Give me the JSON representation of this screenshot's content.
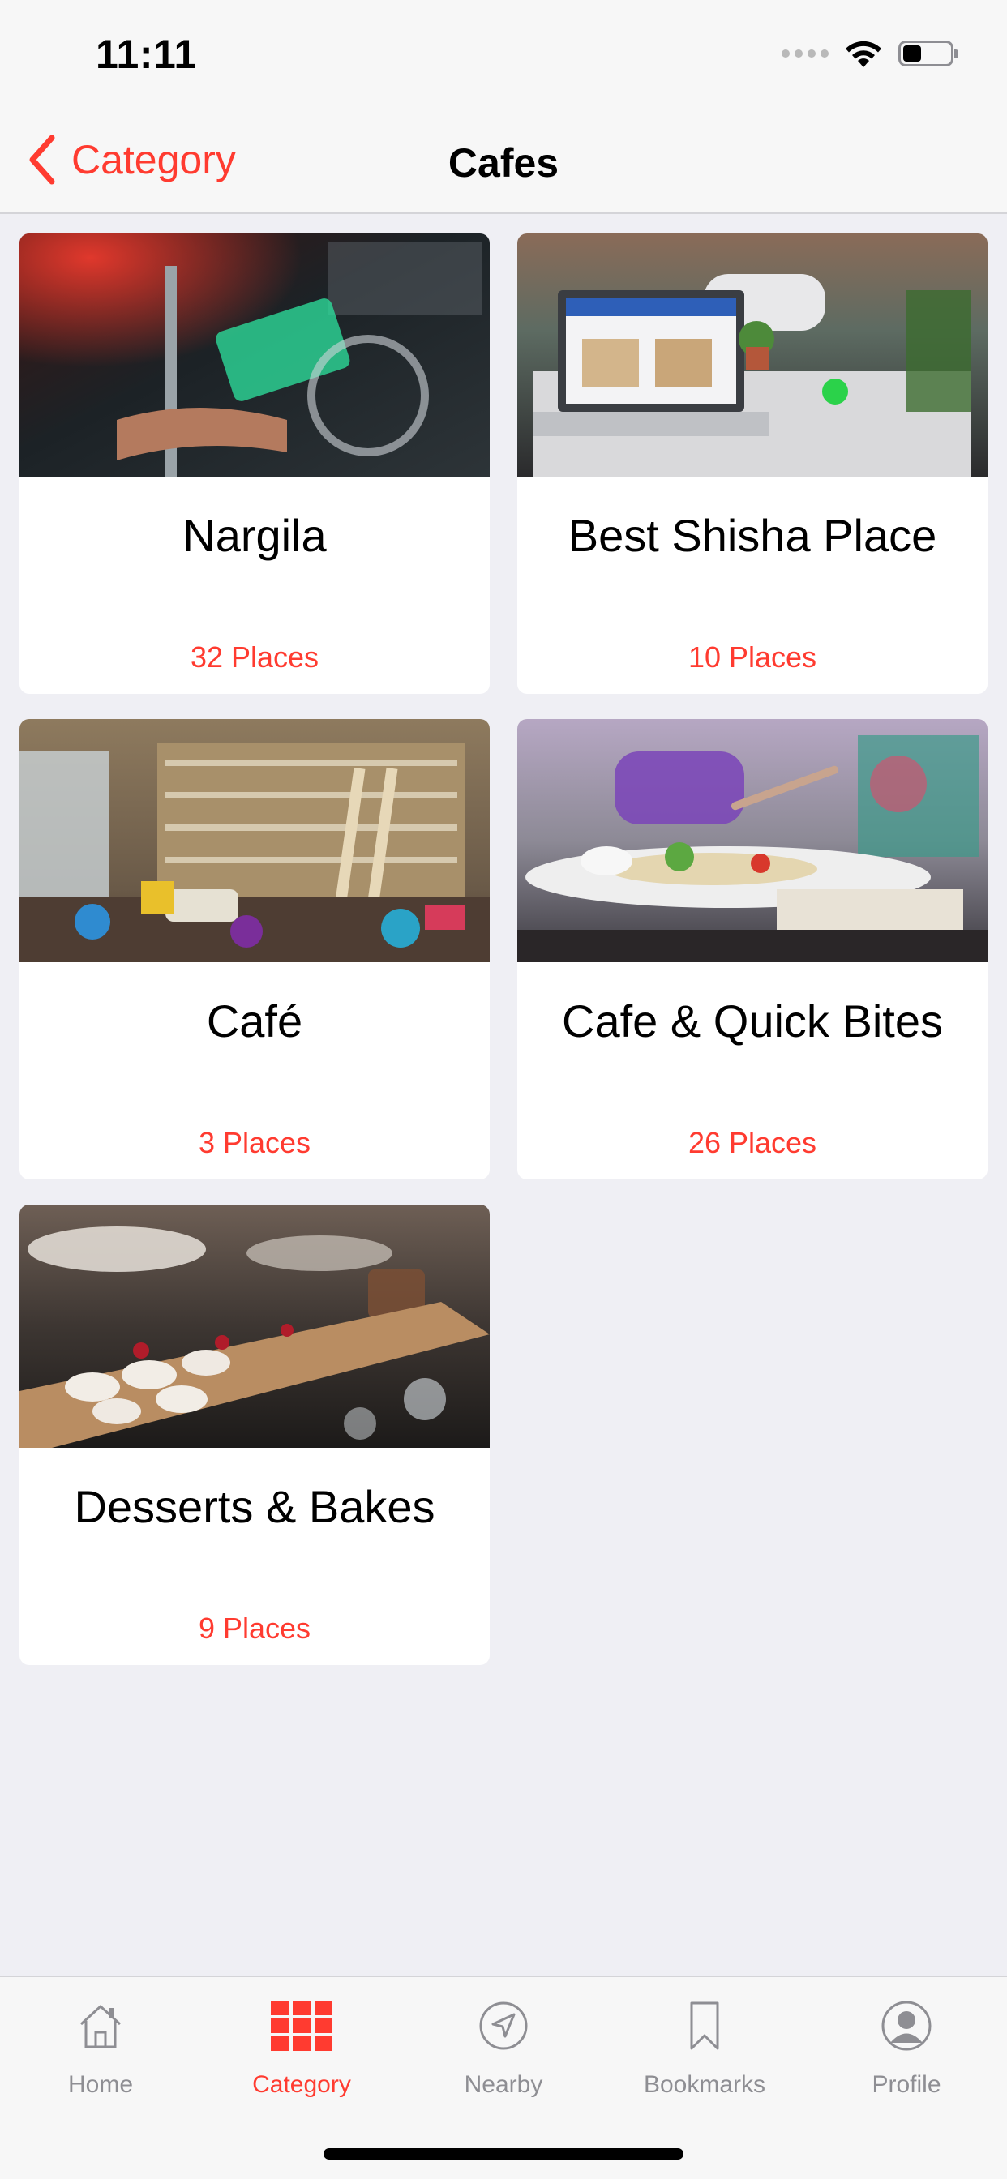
{
  "status_bar": {
    "time": "11:11"
  },
  "nav": {
    "back_label": "Category",
    "title": "Cafes"
  },
  "cards": [
    {
      "title": "Nargila",
      "count": "32 Places",
      "image": "hookah-photo"
    },
    {
      "title": "Best Shisha Place",
      "count": "10 Places",
      "image": "cafe-terrace-laptop-photo"
    },
    {
      "title": "Café",
      "count": "3 Places",
      "image": "library-cafe-interior-photo"
    },
    {
      "title": "Cafe & Quick Bites",
      "count": "26 Places",
      "image": "breakfast-plate-photo"
    },
    {
      "title": "Desserts & Bakes",
      "count": "9 Places",
      "image": "meringue-dessert-photo"
    }
  ],
  "tab_bar": {
    "tabs": [
      {
        "label": "Home",
        "icon": "home-icon"
      },
      {
        "label": "Category",
        "icon": "grid-icon",
        "active": true
      },
      {
        "label": "Nearby",
        "icon": "location-arrow-icon"
      },
      {
        "label": "Bookmarks",
        "icon": "bookmark-icon"
      },
      {
        "label": "Profile",
        "icon": "person-icon"
      }
    ]
  },
  "colors": {
    "accent": "#ff3b30",
    "background": "#efeff4",
    "inactive": "#8e8e93"
  }
}
